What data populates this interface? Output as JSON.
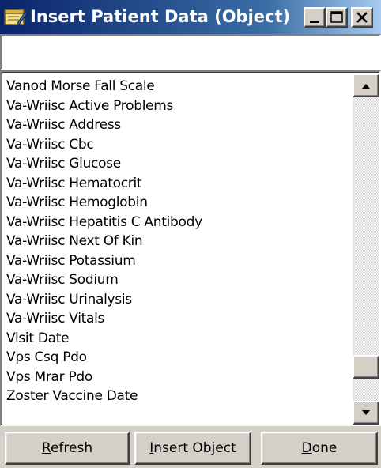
{
  "window": {
    "title": "Insert Patient Data (Object)",
    "controls": {
      "minimize": "minimize",
      "maximize": "maximize",
      "close": "close"
    }
  },
  "search": {
    "value": ""
  },
  "list": {
    "items": [
      "Vanod Morse Fall Scale",
      "Va-Wriisc Active Problems",
      "Va-Wriisc Address",
      "Va-Wriisc Cbc",
      "Va-Wriisc Glucose",
      "Va-Wriisc Hematocrit",
      "Va-Wriisc Hemoglobin",
      "Va-Wriisc Hepatitis C Antibody",
      "Va-Wriisc Next Of Kin",
      "Va-Wriisc Potassium",
      "Va-Wriisc Sodium",
      "Va-Wriisc Urinalysis",
      "Va-Wriisc Vitals",
      "Visit Date",
      "Vps Csq Pdo",
      "Vps Mrar Pdo",
      "Zoster Vaccine Date"
    ],
    "scroll_position": 0.92
  },
  "buttons": {
    "refresh": {
      "mnemonic": "R",
      "rest": "efresh"
    },
    "insert_object": {
      "mnemonic": "I",
      "rest": "nsert Object"
    },
    "done": {
      "mnemonic": "D",
      "rest": "one"
    }
  },
  "colors": {
    "titlebar_start": "#0a246a",
    "titlebar_end": "#a6caf0",
    "face": "#d4d0c8"
  }
}
